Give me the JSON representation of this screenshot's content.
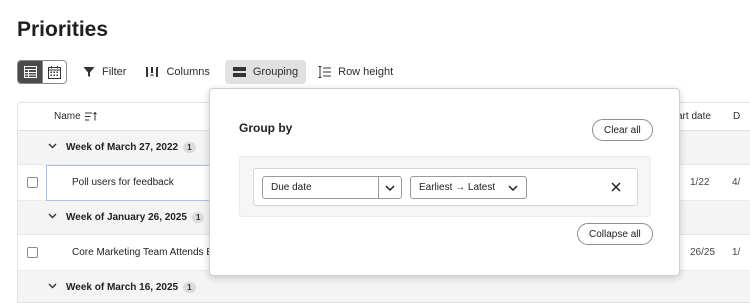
{
  "page": {
    "title": "Priorities"
  },
  "toolbar": {
    "view_toggle": [
      {
        "icon": "table-icon",
        "active": true
      },
      {
        "icon": "calendar-icon",
        "active": false
      }
    ],
    "filter_label": "Filter",
    "columns_label": "Columns",
    "grouping_label": "Grouping",
    "row_height_label": "Row height"
  },
  "grid": {
    "columns": {
      "name": "Name",
      "start": "art date",
      "due": "D"
    },
    "rows": [
      {
        "type": "group",
        "label": "Week of March 27, 2022",
        "count": "1"
      },
      {
        "type": "item",
        "name": "Poll users for feedback",
        "start": "1/22",
        "due": "4/"
      },
      {
        "type": "group",
        "label": "Week of January 26, 2025",
        "count": "1"
      },
      {
        "type": "item",
        "name": "Core Marketing Team Attends E",
        "start": "26/25",
        "due": "1/"
      },
      {
        "type": "group",
        "label": "Week of March 16, 2025",
        "count": "1"
      }
    ]
  },
  "popover": {
    "title": "Group by",
    "clear_all_label": "Clear all",
    "field_value": "Due date",
    "order_value": "Earliest → Latest",
    "collapse_all_label": "Collapse all"
  },
  "colors": {
    "active_toggle": "#4b4b4b",
    "selected_tool": "#e1e1e1",
    "group_row_bg": "#f4f4f4"
  }
}
